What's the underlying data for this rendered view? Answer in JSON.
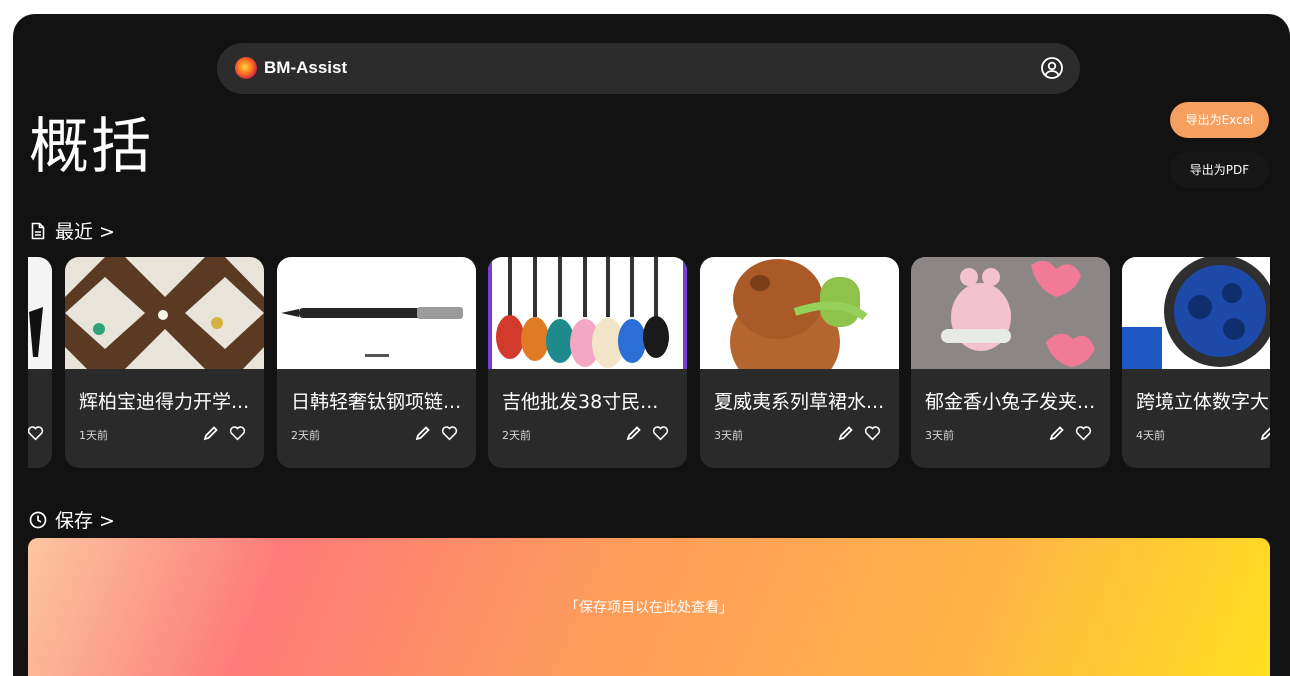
{
  "app": {
    "name": "BM-Assist"
  },
  "header": {
    "user_icon": "user-circle-icon"
  },
  "page": {
    "title": "概括"
  },
  "actions": {
    "export_excel": "导出为Excel",
    "export_pdf": "导出为PDF",
    "accent": "#f6a060"
  },
  "recent": {
    "heading": "最近 >",
    "icon": "document-icon",
    "items": [
      {
        "title": "",
        "time": ""
      },
      {
        "title": "辉柏宝迪得力开学...",
        "time": "1天前"
      },
      {
        "title": "日韩轻奢钛钢项链...",
        "time": "2天前"
      },
      {
        "title": "吉他批发38寸民...",
        "time": "2天前"
      },
      {
        "title": "夏威夷系列草裙水...",
        "time": "3天前"
      },
      {
        "title": "郁金香小兔子发夹...",
        "time": "3天前"
      },
      {
        "title": "跨境立体数字大",
        "time": "4天前"
      }
    ]
  },
  "saved": {
    "heading": "保存 >",
    "icon": "clock-icon",
    "empty_message": "「保存项目以在此处查看」"
  }
}
